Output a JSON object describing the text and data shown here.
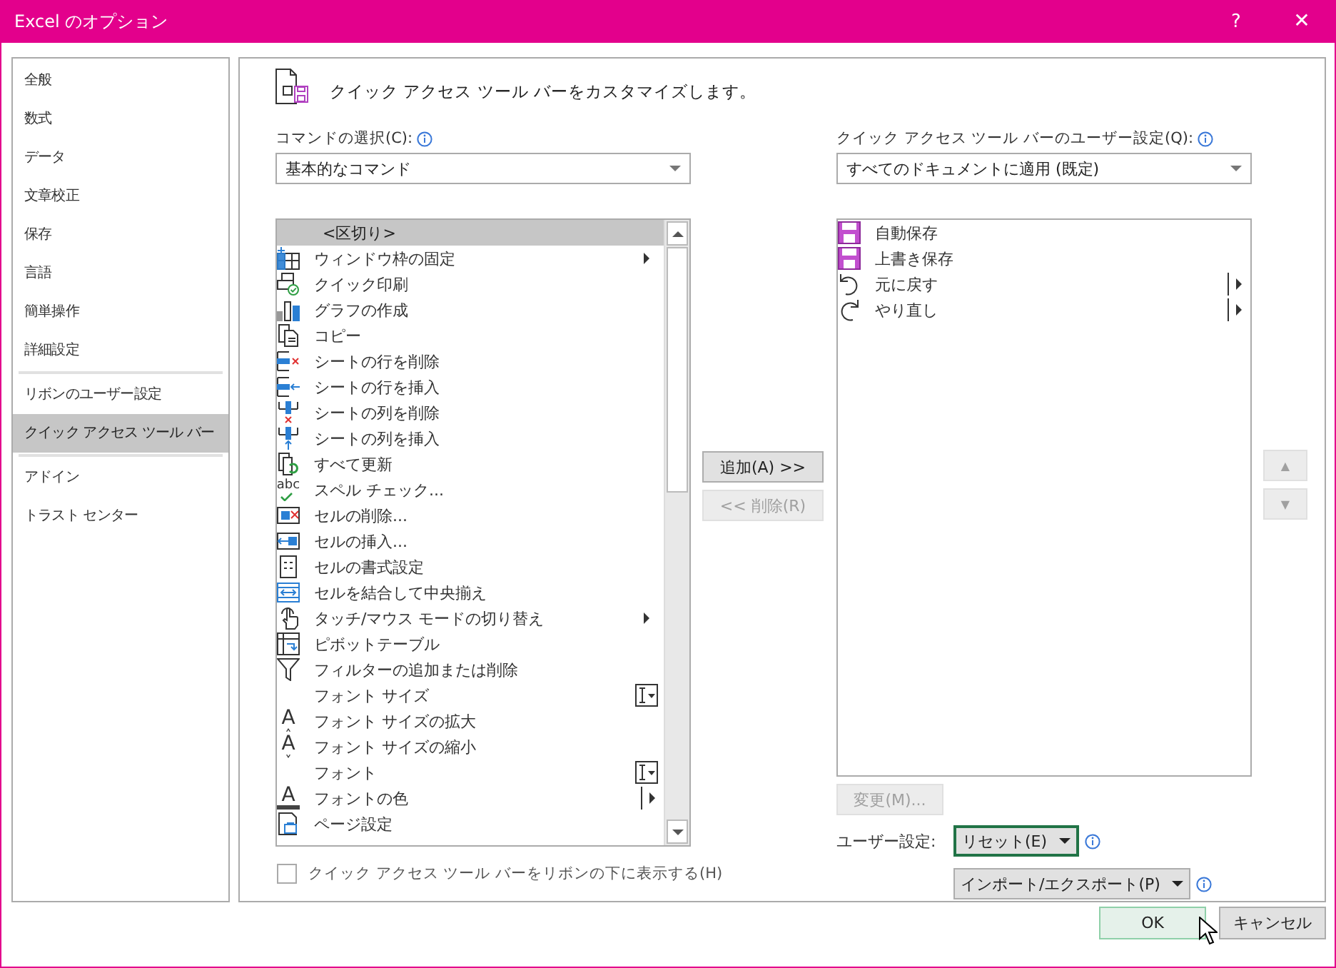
{
  "window": {
    "title": "Excel のオプション",
    "help": "?",
    "close": "✕"
  },
  "sidebar": {
    "sections": [
      [
        {
          "label": "全般",
          "selected": false
        },
        {
          "label": "数式",
          "selected": false
        },
        {
          "label": "データ",
          "selected": false
        },
        {
          "label": "文章校正",
          "selected": false
        },
        {
          "label": "保存",
          "selected": false
        },
        {
          "label": "言語",
          "selected": false
        },
        {
          "label": "簡単操作",
          "selected": false
        },
        {
          "label": "詳細設定",
          "selected": false
        }
      ],
      [
        {
          "label": "リボンのユーザー設定",
          "selected": false
        },
        {
          "label": "クイック アクセス ツール バー",
          "selected": true
        }
      ],
      [
        {
          "label": "アドイン",
          "selected": false
        },
        {
          "label": "トラスト センター",
          "selected": false
        }
      ]
    ]
  },
  "heading": "クイック アクセス ツール バーをカスタマイズします。",
  "commands": {
    "label": "コマンドの選択(C):",
    "dropdown": "基本的なコマンド",
    "items": [
      {
        "label": "<区切り>",
        "kind": "separator",
        "selected": true
      },
      {
        "label": "ウィンドウ枠の固定",
        "kind": "submenu",
        "selected": false
      },
      {
        "label": "クイック印刷",
        "kind": "plain",
        "selected": false
      },
      {
        "label": "グラフの作成",
        "kind": "plain",
        "selected": false
      },
      {
        "label": "コピー",
        "kind": "plain",
        "selected": false
      },
      {
        "label": "シートの行を削除",
        "kind": "plain",
        "selected": false
      },
      {
        "label": "シートの行を挿入",
        "kind": "plain",
        "selected": false
      },
      {
        "label": "シートの列を削除",
        "kind": "plain",
        "selected": false
      },
      {
        "label": "シートの列を挿入",
        "kind": "plain",
        "selected": false
      },
      {
        "label": "すべて更新",
        "kind": "plain",
        "selected": false
      },
      {
        "label": "スペル チェック...",
        "kind": "plain",
        "glyph": "abc",
        "selected": false
      },
      {
        "label": "セルの削除...",
        "kind": "plain",
        "selected": false
      },
      {
        "label": "セルの挿入...",
        "kind": "plain",
        "selected": false
      },
      {
        "label": "セルの書式設定",
        "kind": "plain",
        "selected": false
      },
      {
        "label": "セルを結合して中央揃え",
        "kind": "plain",
        "selected": false
      },
      {
        "label": "タッチ/マウス モードの切り替え",
        "kind": "submenu",
        "selected": false
      },
      {
        "label": "ピボットテーブル",
        "kind": "plain",
        "selected": false
      },
      {
        "label": "フィルターの追加または削除",
        "kind": "plain",
        "selected": false
      },
      {
        "label": "フォント サイズ",
        "kind": "combo",
        "selected": false
      },
      {
        "label": "フォント サイズの拡大",
        "kind": "plain",
        "glyph": "A",
        "selected": false
      },
      {
        "label": "フォント サイズの縮小",
        "kind": "plain",
        "glyph": "A",
        "selected": false
      },
      {
        "label": "フォント",
        "kind": "combo",
        "selected": false
      },
      {
        "label": "フォントの色",
        "kind": "split",
        "glyph": "A",
        "selected": false
      },
      {
        "label": "ページ設定",
        "kind": "plain",
        "selected": false
      }
    ]
  },
  "toolbar": {
    "label": "クイック アクセス ツール バーのユーザー設定(Q):",
    "dropdown": "すべてのドキュメントに適用 (既定)",
    "items": [
      {
        "label": "自動保存",
        "kind": "plain",
        "selected": false
      },
      {
        "label": "上書き保存",
        "kind": "plain",
        "selected": false
      },
      {
        "label": "元に戻す",
        "kind": "split",
        "selected": false
      },
      {
        "label": "やり直し",
        "kind": "split",
        "selected": false
      }
    ]
  },
  "add_button": {
    "label": "追加(A) >>",
    "disabled": false
  },
  "remove_button": {
    "label": "<< 削除(R)",
    "disabled": true
  },
  "move_up": {
    "label": "▲",
    "disabled": true
  },
  "move_down": {
    "label": "▼",
    "disabled": true
  },
  "modify_button": {
    "label": "変更(M)...",
    "disabled": true
  },
  "customizations": {
    "label": "ユーザー設定:",
    "reset": {
      "label": "リセット(E)",
      "focused": true
    },
    "import_export": {
      "label": "インポート/エクスポート(P)",
      "focused": false
    }
  },
  "show_below_ribbon": {
    "label": "クイック アクセス ツール バーをリボンの下に表示する(H)",
    "checked": false
  },
  "ok_button": {
    "label": "OK",
    "hovered": true
  },
  "cancel_button": {
    "label": "キャンセル",
    "hovered": false
  }
}
